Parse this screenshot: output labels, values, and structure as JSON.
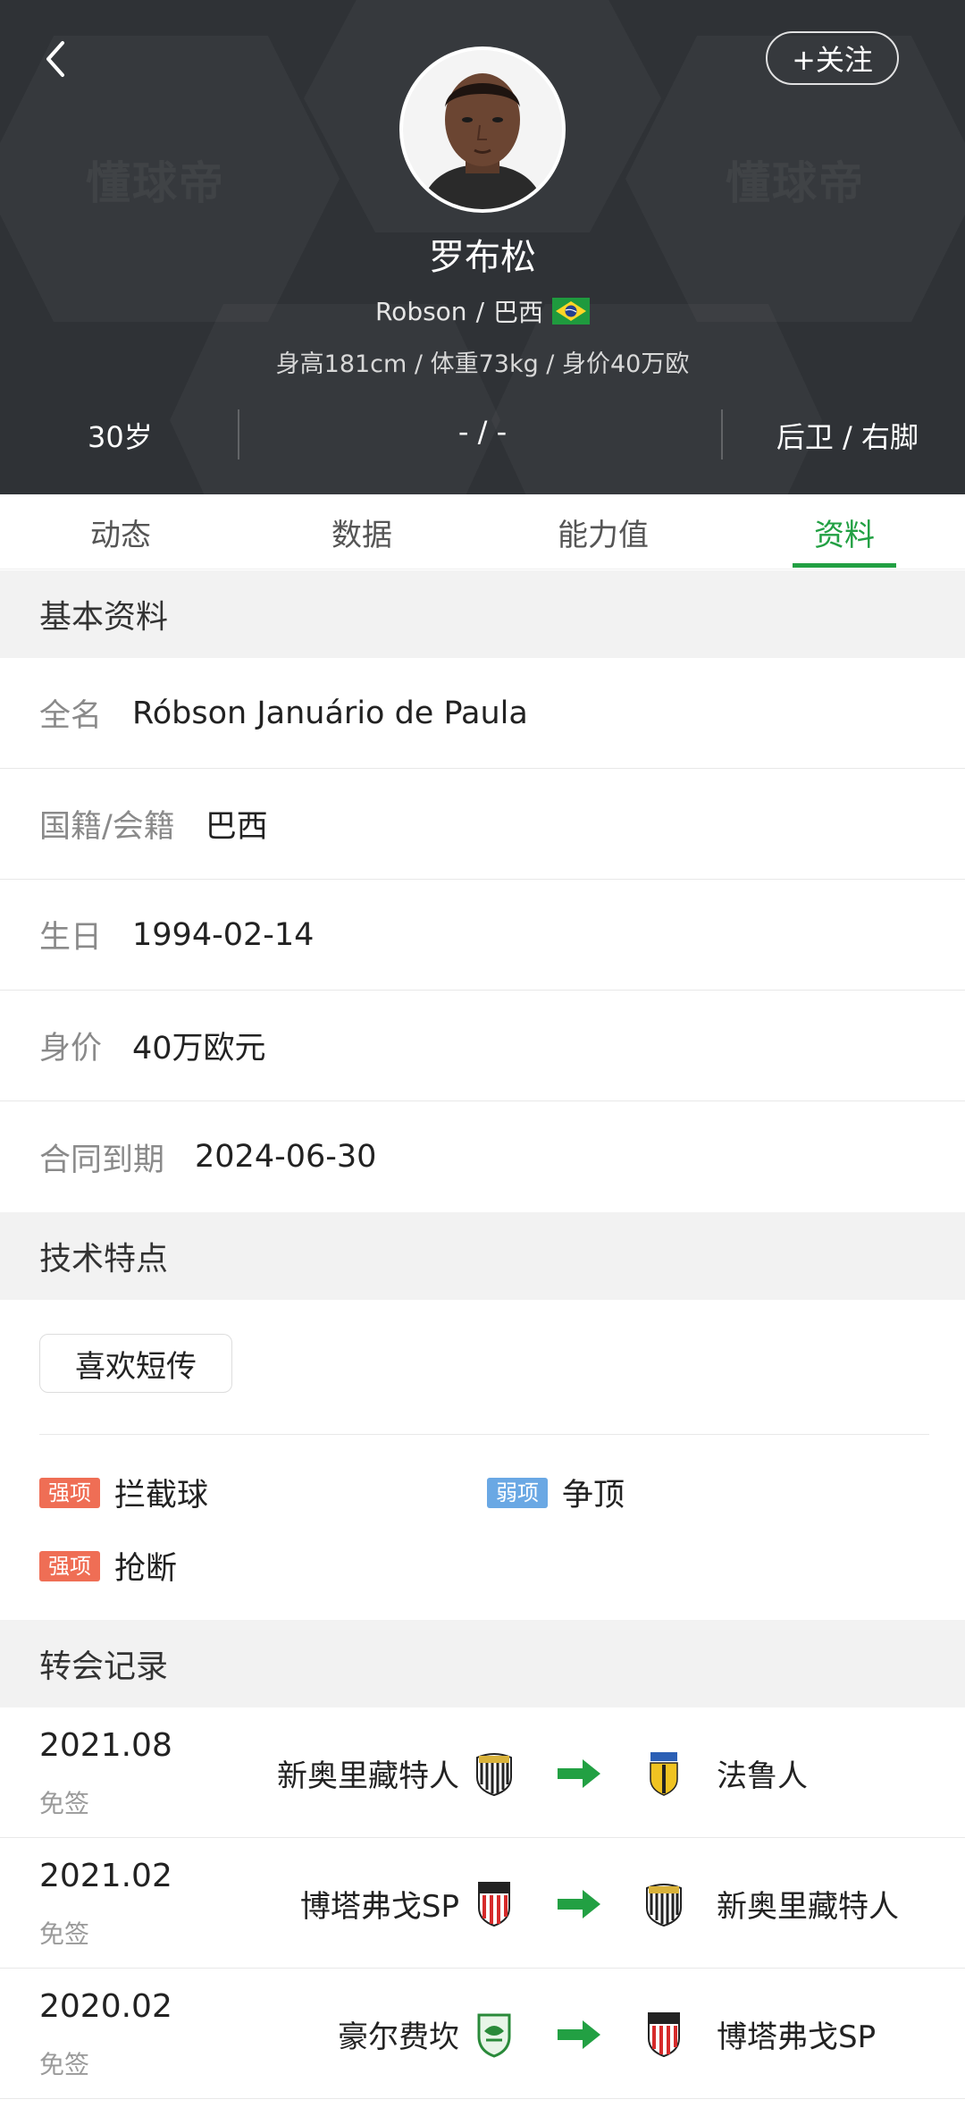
{
  "header": {
    "watermark": "懂球帝",
    "follow_label": "+关注",
    "name": "罗布松",
    "latin_name": "Robson",
    "nationality": "巴西",
    "meta": "身高181cm / 体重73kg / 身价40万欧",
    "age": "30岁",
    "middle": "- / -",
    "position": "后卫 / 右脚"
  },
  "tabs": [
    {
      "label": "动态"
    },
    {
      "label": "数据"
    },
    {
      "label": "能力值"
    },
    {
      "label": "资料"
    }
  ],
  "basic": {
    "title": "基本资料",
    "rows": [
      {
        "label": "全名",
        "value": "Róbson Januário de Paula"
      },
      {
        "label": "国籍/会籍",
        "value": "巴西"
      },
      {
        "label": "生日",
        "value": "1994-02-14"
      },
      {
        "label": "身价",
        "value": "40万欧元"
      },
      {
        "label": "合同到期",
        "value": "2024-06-30"
      }
    ]
  },
  "technical": {
    "title": "技术特点",
    "tag": "喜欢短传",
    "traits": [
      {
        "badge": "强项",
        "text": "拦截球"
      },
      {
        "badge": "弱项",
        "text": "争顶"
      },
      {
        "badge": "强项",
        "text": "抢断"
      }
    ]
  },
  "transfers": {
    "title": "转会记录",
    "rows": [
      {
        "date": "2021.08",
        "type": "免签",
        "from": "新奥里藏特人",
        "to": "法鲁人"
      },
      {
        "date": "2021.02",
        "type": "免签",
        "from": "博塔弗戈SP",
        "to": "新奥里藏特人"
      },
      {
        "date": "2020.02",
        "type": "免签",
        "from": "豪尔费坎",
        "to": "博塔弗戈SP"
      }
    ]
  },
  "colors": {
    "accent": "#22a043",
    "header_bg": "#2f3236",
    "strong_badge": "#ef6e55",
    "weak_badge": "#6aa8e4"
  }
}
